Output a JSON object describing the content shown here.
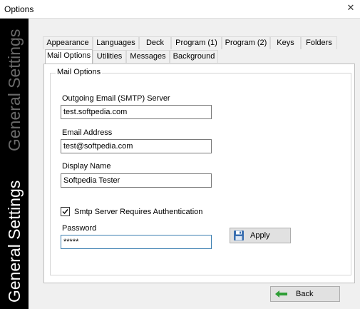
{
  "window": {
    "title": "Options",
    "close_glyph": "✕"
  },
  "sidebar": {
    "bright_text": "General Settings",
    "dim_text": "General Settings"
  },
  "tabs_row1": [
    "Appearance",
    "Languages",
    "Deck",
    "Program (1)",
    "Program (2)",
    "Keys",
    "Folders"
  ],
  "tabs_row2": [
    "Mail Options",
    "Utilities",
    "Messages",
    "Background"
  ],
  "active_tab": "Mail Options",
  "mail_options": {
    "group_title": "Mail Options",
    "smtp_label": "Outgoing Email (SMTP) Server",
    "smtp_value": "test.softpedia.com",
    "email_label": "Email Address",
    "email_value": "test@softpedia.com",
    "name_label": "Display Name",
    "name_value": "Softpedia Tester",
    "auth_label": "Smtp Server Requires Authentication",
    "auth_checked": true,
    "password_label": "Password",
    "password_value": "*****",
    "apply_label": "Apply"
  },
  "footer": {
    "back_label": "Back"
  },
  "colors": {
    "sidebar_bg": "#000000",
    "sidebar_text": "#ffffff",
    "sidebar_dim": "#6a6a6a",
    "back_arrow": "#2e9e36",
    "focus_border": "#3c7fb1"
  },
  "icons": {
    "apply": "floppy-disk-icon",
    "back": "green-arrow-left-icon",
    "check": "checkmark-icon"
  }
}
